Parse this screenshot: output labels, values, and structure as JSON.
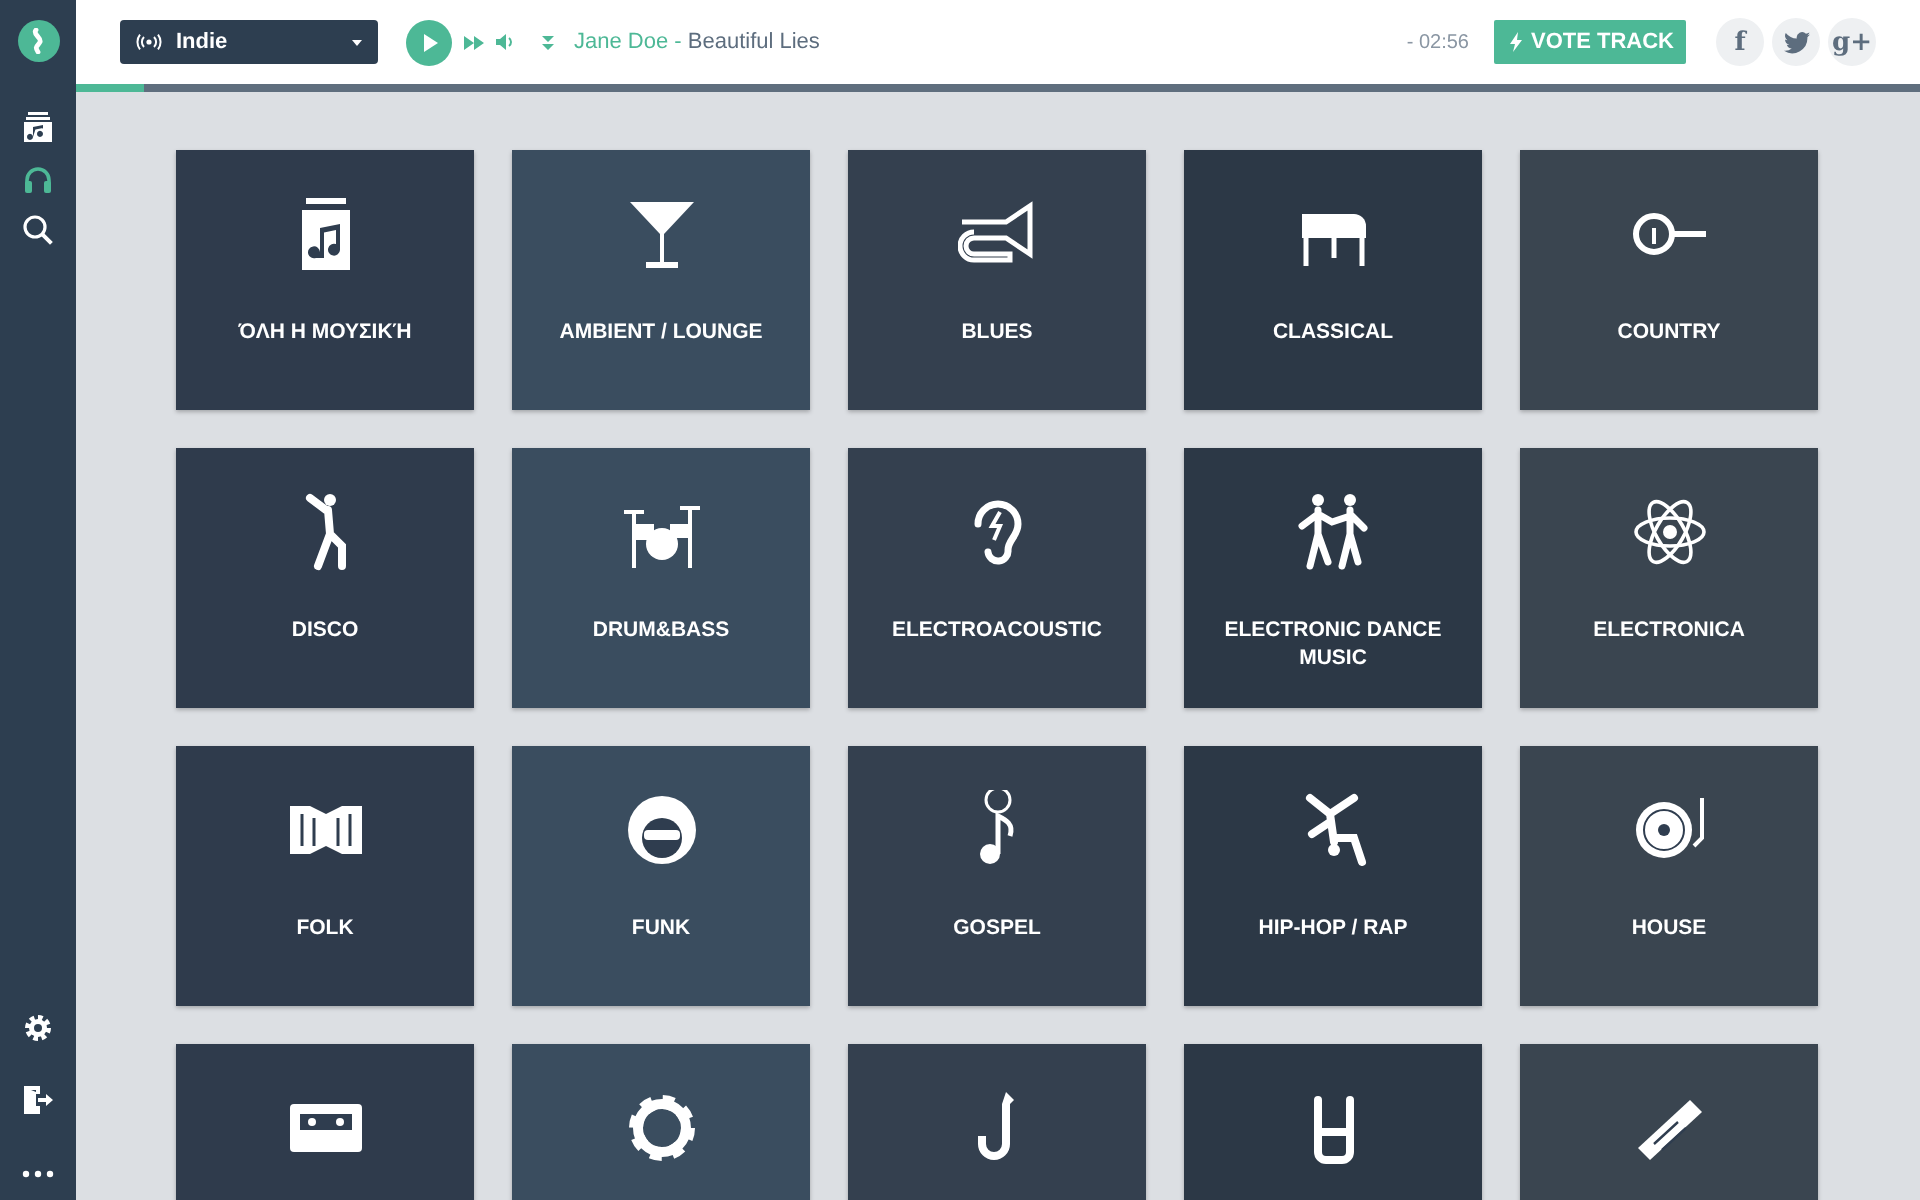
{
  "sidebar": {
    "items": [
      {
        "selected": false
      },
      {
        "selected": true
      },
      {
        "selected": false
      }
    ]
  },
  "player": {
    "station": "Indie",
    "artist": "Jane Doe",
    "separator": " - ",
    "title": "Beautiful Lies",
    "time": "- 02:56",
    "vote_button": "VOTE TRACK",
    "progress": {
      "level": 0.037
    }
  },
  "social": [
    {
      "kind": "text",
      "label": "f"
    },
    {
      "kind": "bird"
    },
    {
      "kind": "text",
      "label": "g+"
    }
  ],
  "genres": [
    {
      "kind": "labeled",
      "label": "ΌΛΗ Η ΜΟΥΣΙΚΉ"
    },
    {
      "kind": "labeled",
      "label": "AMBIENT / LOUNGE"
    },
    {
      "kind": "labeled",
      "label": "BLUES"
    },
    {
      "kind": "labeled",
      "label": "CLASSICAL"
    },
    {
      "kind": "labeled",
      "label": "COUNTRY"
    },
    {
      "kind": "labeled",
      "label": "DISCO"
    },
    {
      "kind": "labeled",
      "label": "DRUM&BASS"
    },
    {
      "kind": "labeled",
      "label": "ELECTROACOUSTIC"
    },
    {
      "kind": "labeled",
      "label": "ELECTRONIC DANCE MUSIC"
    },
    {
      "kind": "labeled",
      "label": "ELECTRONICA"
    },
    {
      "kind": "labeled",
      "label": "FOLK"
    },
    {
      "kind": "labeled",
      "label": "FUNK"
    },
    {
      "kind": "labeled",
      "label": "GOSPEL"
    },
    {
      "kind": "labeled",
      "label": "HIP-HOP / RAP"
    },
    {
      "kind": "labeled",
      "label": "HOUSE"
    },
    {
      "kind": "cut_off"
    },
    {
      "kind": "cut_off"
    },
    {
      "kind": "cut_off"
    },
    {
      "kind": "cut_off"
    },
    {
      "kind": "cut_off"
    }
  ]
}
